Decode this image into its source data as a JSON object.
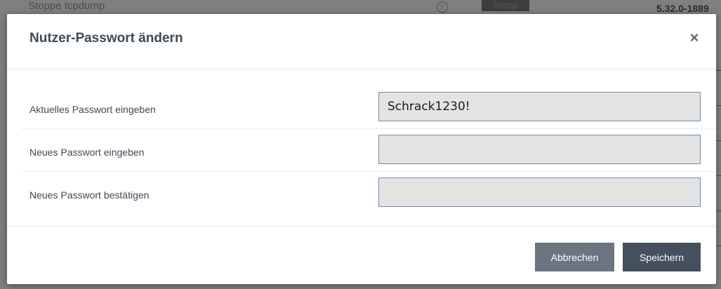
{
  "background": {
    "row_label": "Stoppe tcpdump",
    "info_icon": "i",
    "button_label": "Stopp",
    "version": "5.32.0-1889"
  },
  "modal": {
    "title": "Nutzer-Passwort ändern",
    "close_glyph": "×",
    "fields": [
      {
        "label": "Aktuelles Passwort eingeben",
        "value": "Schrack1230!"
      },
      {
        "label": "Neues Passwort eingeben",
        "value": ""
      },
      {
        "label": "Neues Passwort bestätigen",
        "value": ""
      }
    ],
    "buttons": {
      "cancel": "Abbrechen",
      "save": "Speichern"
    }
  },
  "colors": {
    "title": "#3d4a57",
    "input_bg": "#e3e3e3",
    "input_border": "#6b8fb3",
    "cancel_btn": "#6b7480",
    "save_btn": "#44505d"
  }
}
